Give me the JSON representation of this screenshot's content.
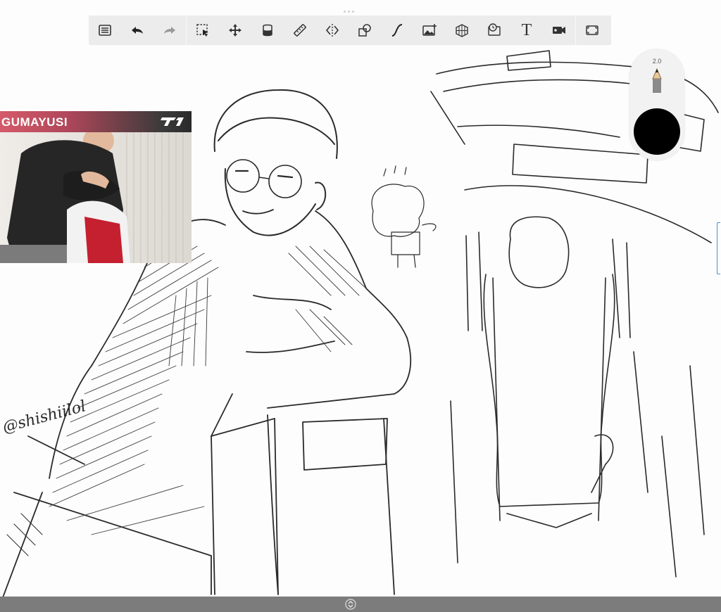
{
  "toolbar": {
    "items": [
      {
        "icon": "list-icon"
      },
      {
        "icon": "undo-icon"
      },
      {
        "icon": "redo-icon"
      },
      {
        "icon": "selection-icon"
      },
      {
        "icon": "transform-icon"
      },
      {
        "icon": "fill-icon"
      },
      {
        "icon": "ruler-icon"
      },
      {
        "icon": "symmetry-icon"
      },
      {
        "icon": "shapes-icon"
      },
      {
        "icon": "curve-icon"
      },
      {
        "icon": "image-import-icon"
      },
      {
        "icon": "perspective-icon"
      },
      {
        "icon": "time-lapse-icon"
      },
      {
        "icon": "text-icon",
        "label": "T"
      },
      {
        "icon": "video-record-icon"
      },
      {
        "icon": "fullscreen-icon"
      }
    ]
  },
  "brush": {
    "size": "2.0",
    "color": "#000000"
  },
  "overlay": {
    "banner_text": "GUMAYUSI",
    "logo": "t1-logo"
  },
  "artwork": {
    "signature": "@shishiilol"
  },
  "bottom_bar": {
    "icon": "expand-collapse-icon"
  },
  "colors": {
    "toolbar_bg": "#ececec",
    "banner_start": "#d45a6a",
    "banner_end": "#2a2a2a",
    "bottom_bar": "#7c7c7c",
    "accent": "#4a90d9"
  }
}
